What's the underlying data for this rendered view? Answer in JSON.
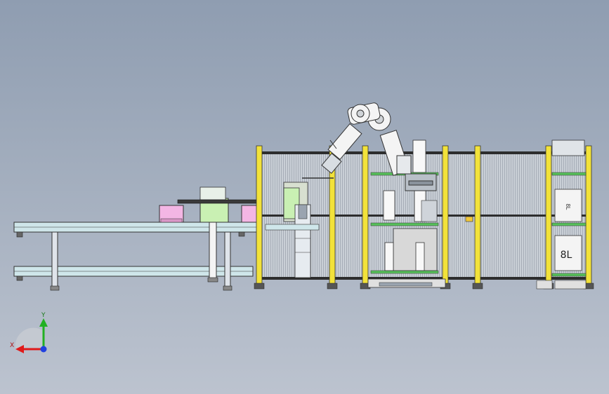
{
  "scene": {
    "title": "",
    "background_top": "#8f9db1",
    "background_bottom": "#bcc3cf",
    "frame_yellow": "#f2e23a",
    "guard_mesh": "#c9cfd6",
    "conveyor_color": "#cfe6ea",
    "robot_color": "#f4f4f4",
    "tote_pink": "#f3b6e4",
    "part_green": "#c9f0b3",
    "shelf_green": "#57c05b"
  },
  "labels": {
    "bin_marking": "8L",
    "bin_marking_small": "8L"
  },
  "axis_triad": {
    "x_label": "X",
    "y_label": "Y",
    "x_color": "#e01a1a",
    "y_color": "#22b022",
    "z_color": "#2040e0"
  }
}
